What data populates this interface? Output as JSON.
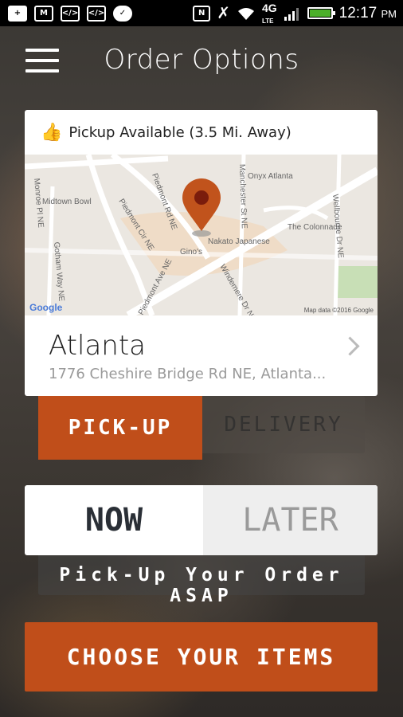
{
  "status_bar": {
    "time": "12:17",
    "ampm": "PM",
    "network": "4G",
    "network_sub": "LTE",
    "icons": [
      "plus-icon",
      "gmail-icon",
      "code-icon",
      "code-icon",
      "chat-icon",
      "nfc-icon",
      "mute-icon",
      "wifi-icon",
      "signal-icon",
      "battery-icon"
    ]
  },
  "header": {
    "title": "Order Options"
  },
  "location_card": {
    "availability": "Pickup Available (3.5 Mi. Away)",
    "city": "Atlanta",
    "address": "1776 Cheshire Bridge Rd NE, Atlanta...",
    "map": {
      "places": [
        "Onyx Atlanta",
        "Midtown Bowl",
        "The Colonnade",
        "Nakato Japanese",
        "Gino's"
      ],
      "streets": [
        "Piedmont Rd NE",
        "Piedmont Cir NE",
        "Manchester St NE",
        "Monroe Pl NE",
        "Gotham Way NE",
        "Piedmont Ave NE",
        "Windemere Dr NE",
        "Wellbourne Dr NE"
      ],
      "attribution_logo": "Google",
      "attribution": "Map data ©2016 Google"
    }
  },
  "fulfillment": {
    "pickup_label": "PICK-UP",
    "delivery_label": "DELIVERY",
    "selected": "pickup"
  },
  "timing": {
    "now_label": "NOW",
    "later_label": "LATER",
    "selected": "now",
    "hint": "Pick-Up Your Order ASAP"
  },
  "cta": {
    "label": "CHOOSE YOUR ITEMS"
  },
  "colors": {
    "accent": "#c04e1a",
    "pin": "#c1531c",
    "status_bar": "#000000",
    "battery": "#4caf2a"
  }
}
